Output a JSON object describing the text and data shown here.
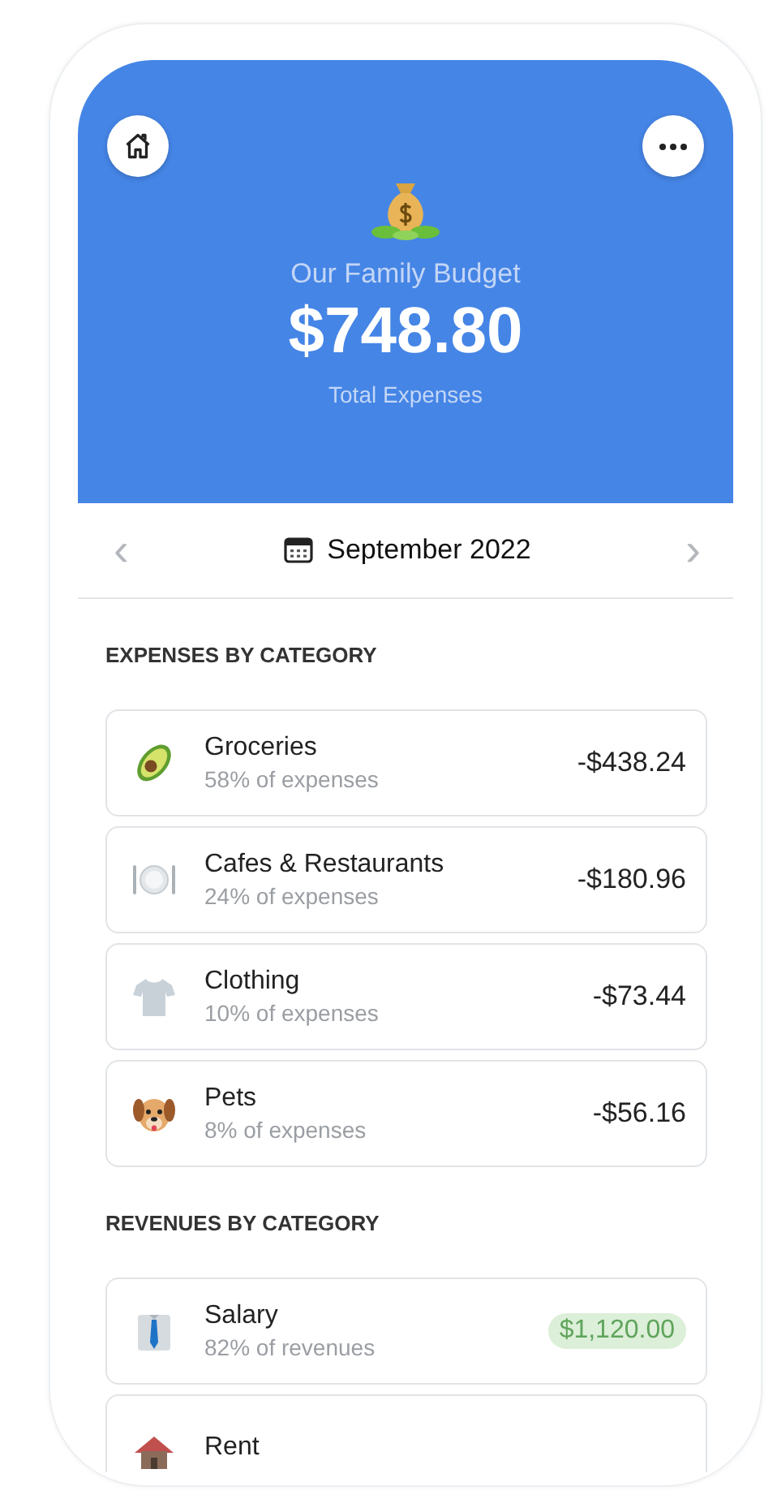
{
  "header": {
    "title": "Our Family Budget",
    "total": "$748.80",
    "subtitle": "Total Expenses"
  },
  "month_nav": {
    "prev": "‹",
    "label": "September 2022",
    "next": "›"
  },
  "sections": [
    {
      "kind": "expense",
      "title": "EXPENSES BY CATEGORY",
      "items": [
        {
          "name": "Groceries",
          "share": "58% of expenses",
          "amount": "-$438.24"
        },
        {
          "name": "Cafes & Restaurants",
          "share": "24% of expenses",
          "amount": "-$180.96"
        },
        {
          "name": "Clothing",
          "share": "10% of expenses",
          "amount": "-$73.44"
        },
        {
          "name": "Pets",
          "share": "8% of expenses",
          "amount": "-$56.16"
        }
      ]
    },
    {
      "kind": "revenue",
      "title": "REVENUES BY CATEGORY",
      "items": [
        {
          "name": "Salary",
          "share": "82% of revenues",
          "amount": "$1,120.00"
        },
        {
          "name": "Rent"
        }
      ]
    }
  ]
}
